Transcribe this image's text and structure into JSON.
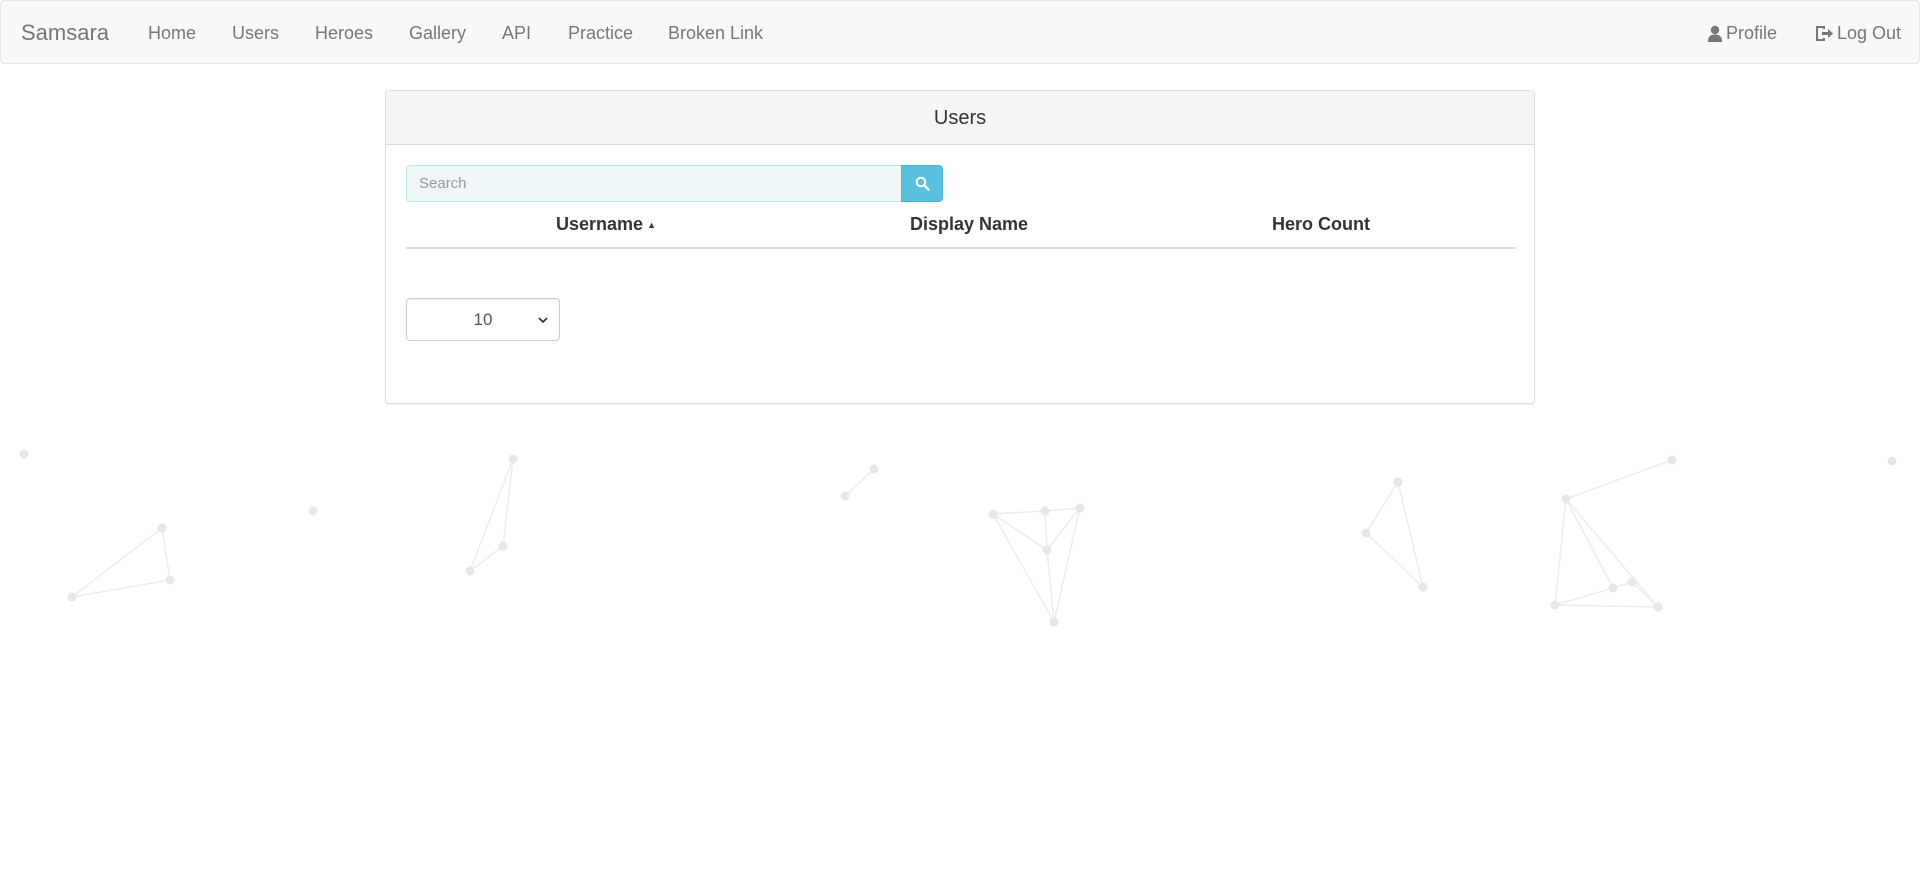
{
  "navbar": {
    "brand": "Samsara",
    "items": [
      {
        "label": "Home"
      },
      {
        "label": "Users"
      },
      {
        "label": "Heroes"
      },
      {
        "label": "Gallery"
      },
      {
        "label": "API"
      },
      {
        "label": "Practice"
      },
      {
        "label": "Broken Link"
      }
    ],
    "right": [
      {
        "label": "Profile",
        "icon": "user-icon"
      },
      {
        "label": "Log Out",
        "icon": "logout-icon"
      }
    ]
  },
  "panel": {
    "title": "Users",
    "search": {
      "placeholder": "Search",
      "value": "",
      "button_icon": "search-icon"
    },
    "columns": [
      {
        "label": "Username",
        "sorted": "ascending"
      },
      {
        "label": "Display Name"
      },
      {
        "label": "Hero Count"
      }
    ],
    "rows": [],
    "page_size": {
      "selected": "10"
    }
  },
  "colors": {
    "navbar_bg": "#f8f8f8",
    "nav_text": "#777777",
    "panel_heading_bg": "#f5f5f5",
    "search_button": "#5bc0de",
    "network_decoration": "#e8e8e8"
  }
}
